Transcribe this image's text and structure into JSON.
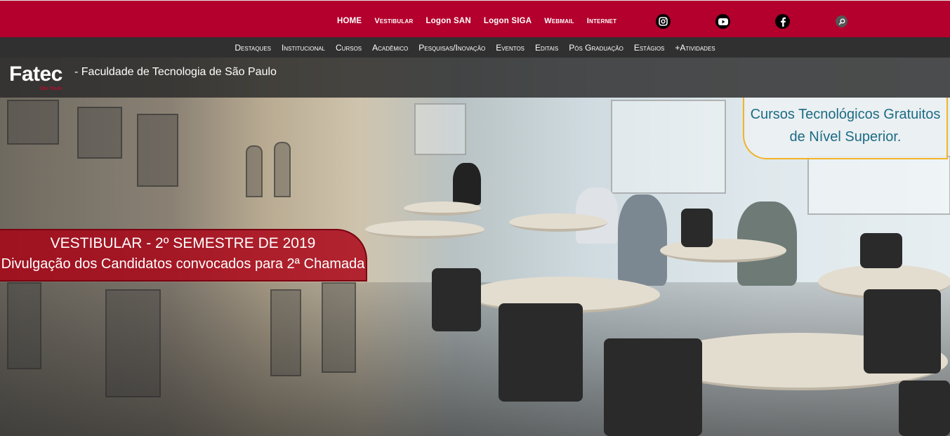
{
  "top_nav": {
    "items": [
      "HOME",
      "Vestibular",
      "Logon SAN",
      "Logon SIGA",
      "Webmail",
      "Internet"
    ]
  },
  "social": {
    "icons": [
      "instagram-icon",
      "youtube-icon",
      "facebook-icon",
      "search-icon"
    ]
  },
  "main_nav": {
    "items": [
      "Destaques",
      "Institucional",
      "Cursos",
      "Acadêmico",
      "Pesquisas/Inovação",
      "Eventos",
      "Editais",
      "Pós Graduação",
      "Estágios",
      "+Atividades"
    ]
  },
  "brand": {
    "logo": "Fatec",
    "logo_sub": "São Paulo",
    "title": "- Faculdade de Tecnologia de São Paulo"
  },
  "hero": {
    "tagline_line1": "Cursos Tecnológicos Gratuitos",
    "tagline_line2": "de Nível Superior.",
    "banner_line1": "VESTIBULAR - 2º SEMESTRE DE 2019",
    "banner_line2": "Divulgação dos Candidatos convocados para 2ª Chamada"
  },
  "colors": {
    "top_bar": "#b3002d",
    "main_nav": "#303030",
    "tagline_text": "#1c6b84",
    "tagline_border": "#f0b429",
    "banner_bg": "#aa0014"
  }
}
